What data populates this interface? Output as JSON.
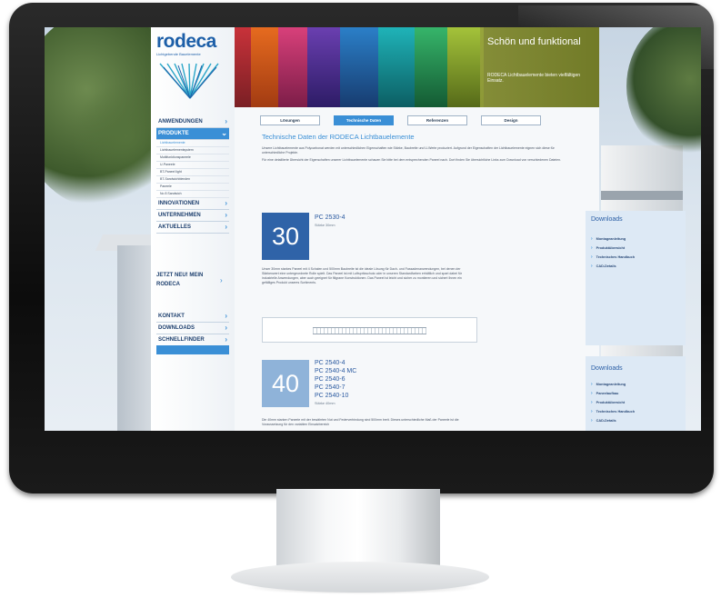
{
  "logo": {
    "name": "rodeca",
    "tagline": "Lichtgebende Bauelemente"
  },
  "banner": {
    "title": "Schön und funktional",
    "subtitle": "RODECA Lichtbauelemente bieten vielfältigen Einsatz."
  },
  "nav": {
    "top": [
      {
        "label": "ANWENDUNGEN"
      },
      {
        "label": "PRODUKTE"
      }
    ],
    "sub": [
      "Lichtbauelemente",
      "Lichtbauelementsystem",
      "Multifunktionspaneele",
      "U-Paneele",
      "BT-Paneel light",
      "BT-Sandwichblenden",
      "Paneele",
      "No 8 Sandwich"
    ],
    "mid": [
      {
        "label": "INNOVATIONEN"
      },
      {
        "label": "UNTERNEHMEN"
      },
      {
        "label": "AKTUELLES"
      }
    ],
    "promo": "JETZT NEU! MEIN RODECA",
    "bottom": [
      {
        "label": "KONTAKT"
      },
      {
        "label": "DOWNLOADS"
      },
      {
        "label": "SCHNELLFINDER"
      }
    ]
  },
  "tabs": [
    "Lösungen",
    "Technische Daten",
    "Referenzen",
    "Design"
  ],
  "content": {
    "heading": "Technische Daten der RODECA Lichtbauelemente",
    "intro1": "Unsere Lichtbauelemente aus Polycarbonat werden mit unterschiedlichen Eigenschaften wie Stärke, Baubreite und U-Werte produziert. Aufgrund der Eigenschaften der Lichtbauelemente eignen sich diese für unterschiedliche Projekte.",
    "intro2": "Für eine detaillierte Übersicht der Eigenschaften unserer Lichtbauelemente schauen Sie bitte bei dem entsprechenden Paneel nach. Dort finden Sie übersichtliche Links zum Download von verschiedenen Dateien."
  },
  "products": [
    {
      "number": "30",
      "models": [
        "PC 2530-4"
      ],
      "thickness": "Stärke 30mm",
      "description": "Unser 30mm starkes Paneel mit 4 Schalen und 500mm Baubreite ist die ideale Lösung für Dach- und Fassadenanwendungen, bei denen der Stärkenwert eine untergeordnete Rolle spielt. Das Paneel ist mit Luftspritzschutz oder in unseren Standardfarben erhältlich und spart dabei für industrielle Anwendungen, aber auch geeignet für filigrane Konstruktionen. Das Paneel ist leicht und sicher zu montieren und sichert Ihnen ein gefälliges Produkt unseres Sortiments.",
      "downloads_title": "Downloads",
      "downloads": [
        "Montageanleitung",
        "Produktübersicht",
        "Technisches Handbuch",
        "CAD-Details"
      ]
    },
    {
      "number": "40",
      "models": [
        "PC 2540-4",
        "PC 2540-4 MC",
        "PC 2540-6",
        "PC 2540-7",
        "PC 2540-10"
      ],
      "thickness": "Stärke 40mm",
      "description": "Die 40mm starken Paneele mit der bewährten Nut und Federverbindung sind 500mm breit. Dieses unterschiedliche Maß der Paneele ist die Voraussetzung für den variablen Einsatzbereich",
      "downloads_title": "Downloads",
      "downloads": [
        "Montageanleitung",
        "Paneelaufbau",
        "Produktübersicht",
        "Technisches Handbuch",
        "CAD-Details"
      ]
    }
  ],
  "colors": {
    "accent": "#3a8fd6",
    "nav_text": "#1d3f6e",
    "box_30": "#2f63a8",
    "box_40": "#8fb3d9",
    "banner_copy": "#96a03c",
    "download_bg": "#dde9f5"
  }
}
